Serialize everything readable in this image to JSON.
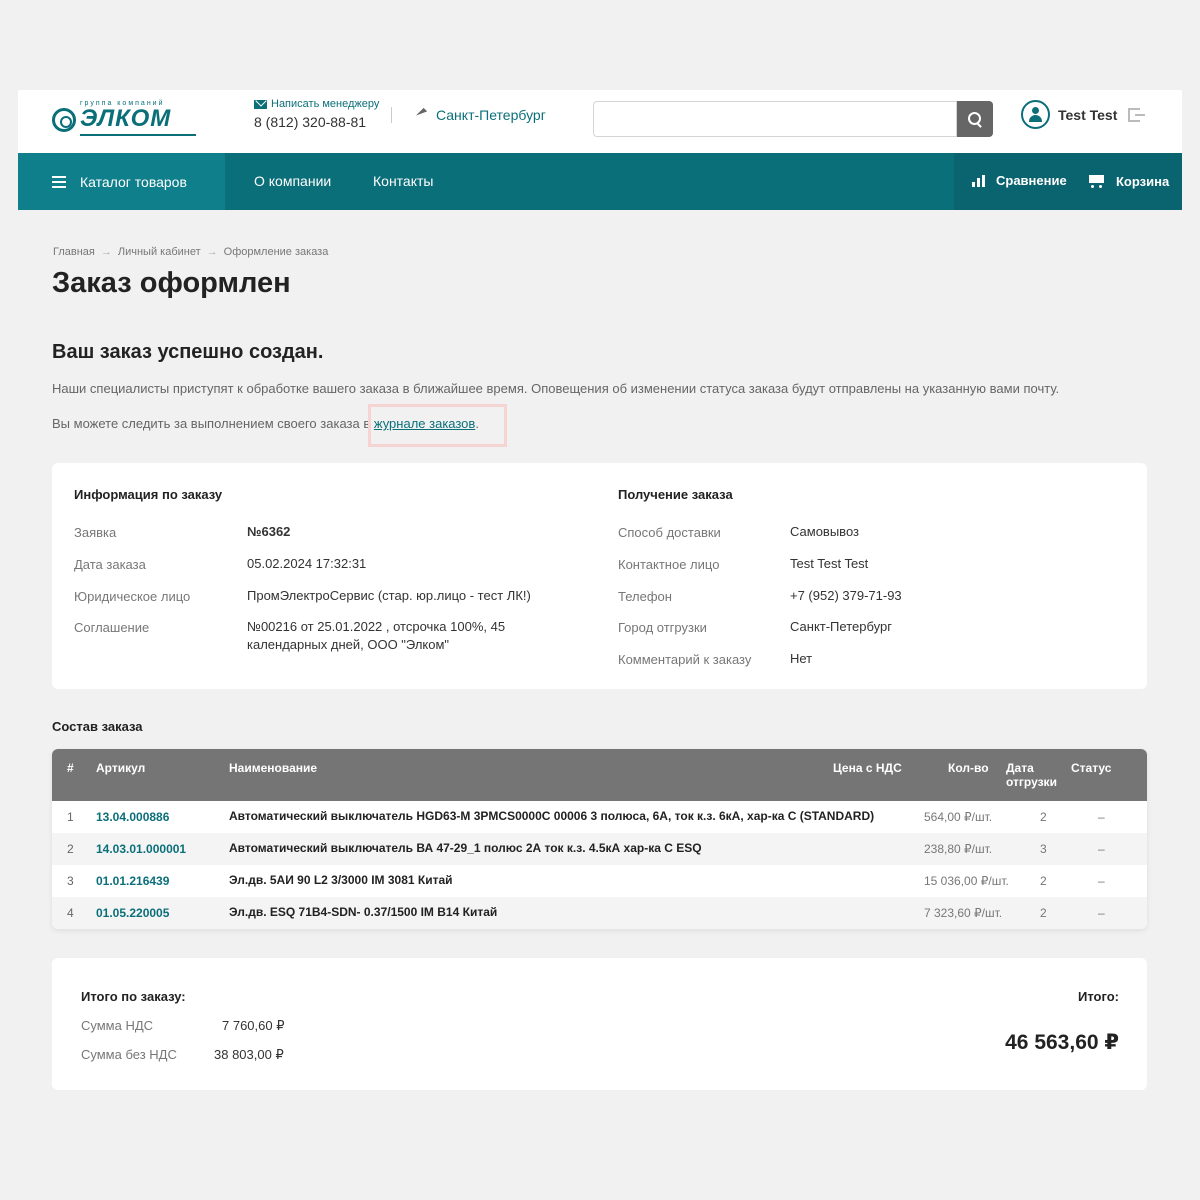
{
  "header": {
    "logo_group": "группа компаний",
    "logo_word": "ЭЛКОМ",
    "write_manager": "Написать менеджеру",
    "phone": "8 (812) 320-88-81",
    "city": "Санкт-Петербург",
    "search_value": "",
    "user_name": "Test Test"
  },
  "nav": {
    "catalog": "Каталог товаров",
    "about": "О компании",
    "contacts": "Контакты",
    "compare": "Сравнение",
    "cart": "Корзина"
  },
  "breadcrumb": [
    "Главная",
    "Личный кабинет",
    "Оформление заказа"
  ],
  "page_title": "Заказ оформлен",
  "success_title": "Ваш заказ успешно создан.",
  "info_text": "Наши специалисты приступят к обработке вашего заказа в ближайшее время. Оповещения об изменении статуса заказа будут отправлены на указанную вами почту.",
  "follow_text": "Вы можете следить за выполнением своего заказа в ",
  "follow_link": "журнале заказов",
  "follow_end": ".",
  "order_info": {
    "title": "Информация по заказу",
    "request_label": "Заявка",
    "request_value": "№6362",
    "date_label": "Дата заказа",
    "date_value": "05.02.2024 17:32:31",
    "entity_label": "Юридическое лицо",
    "entity_value": "ПромЭлектроСервис (стар. юр.лицо - тест ЛК!)",
    "agreement_label": "Соглашение",
    "agreement_line1": "№00216 от 25.01.2022 , отсрочка 100%, 45",
    "agreement_line2": "календарных дней, ООО \"Элком\""
  },
  "receipt": {
    "title": "Получение заказа",
    "delivery_label": "Способ доставки",
    "delivery_value": "Самовывоз",
    "contact_label": "Контактное лицо",
    "contact_value": "Test Test Test",
    "phone_label": "Телефон",
    "phone_value": "+7 (952) 379-71-93",
    "city_label": "Город отгрузки",
    "city_value": "Санкт-Петербург",
    "comment_label": "Комментарий к заказу",
    "comment_value": "Нет"
  },
  "composition": {
    "title": "Состав заказа",
    "headers": {
      "num": "#",
      "sku": "Артикул",
      "name": "Наименование",
      "price": "Цена с НДС",
      "qty": "Кол-во",
      "date1": "Дата",
      "date2": "отгрузки",
      "status": "Статус"
    },
    "rows": [
      {
        "num": "1",
        "sku": "13.04.000886",
        "name": "Автоматический выключатель HGD63-M 3PMCS0000C 00006 3 полюса, 6А, ток к.з. 6кА, хар-ка С (STANDARD)",
        "price": "564,00 ₽/шт.",
        "qty": "2",
        "status": "–"
      },
      {
        "num": "2",
        "sku": "14.03.01.000001",
        "name": "Автоматический выключатель ВА 47-29_1 полюс 2А ток к.з. 4.5кА хар-ка С ESQ",
        "price": "238,80 ₽/шт.",
        "qty": "3",
        "status": "–"
      },
      {
        "num": "3",
        "sku": "01.01.216439",
        "name": "Эл.дв. 5АИ 90 L2 3/3000 IM 3081 Китай",
        "price": "15 036,00 ₽/шт.",
        "qty": "2",
        "status": "–"
      },
      {
        "num": "4",
        "sku": "01.05.220005",
        "name": "Эл.дв. ESQ 71B4-SDN- 0.37/1500 IM B14 Китай",
        "price": "7 323,60 ₽/шт.",
        "qty": "2",
        "status": "–"
      }
    ]
  },
  "totals": {
    "title": "Итого по заказу:",
    "vat_label": "Сумма НДС",
    "vat_value": "7 760,60 ₽",
    "novat_label": "Сумма без НДС",
    "novat_value": "38 803,00 ₽",
    "total_label": "Итого:",
    "total_value": "46 563,60 ₽"
  },
  "colors": {
    "brand": "#0b6f7a",
    "table_header": "#757575"
  }
}
